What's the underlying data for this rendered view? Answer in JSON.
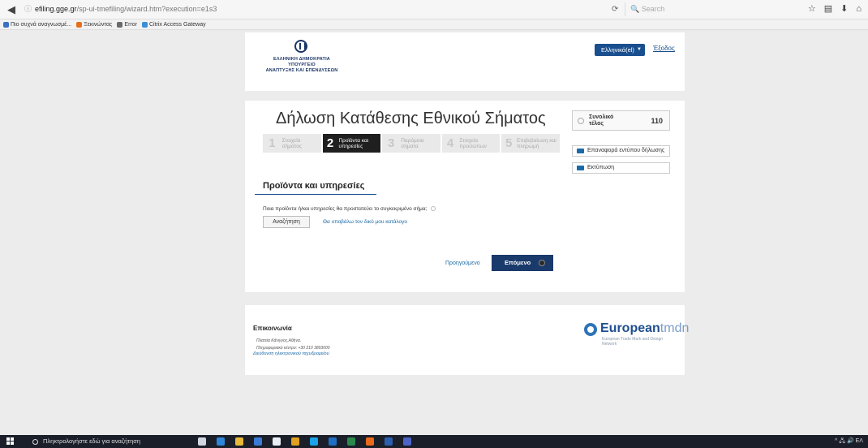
{
  "browser": {
    "url_domain": "efiling.gge.gr",
    "url_prefix": "",
    "url_path": "/sp-ui-tmefiling/wizard.htm?execution=e1s3",
    "search_placeholder": "Search",
    "bookmarks": [
      {
        "label": "Πιο συχνά αναγνωσμέ...",
        "color": "#3a6fc4"
      },
      {
        "label": "Ξεκινώντας",
        "color": "#e76f1a"
      },
      {
        "label": "Error",
        "color": "#6a6a6a"
      },
      {
        "label": "Citrix Access Gateway",
        "color": "#3a8fd8"
      }
    ]
  },
  "header": {
    "org_line1": "ΕΛΛΗΝΙΚΗ ΔΗΜΟΚΡΑΤΙΑ",
    "org_line2": "ΥΠΟΥΡΓΕΙΟ",
    "org_line3": "ΑΝΑΠΤΥΞΗΣ ΚΑΙ ΕΠΕΝΔΥΣΕΩΝ",
    "language": "Ελληνικά(el)",
    "exit": "Έξοδος"
  },
  "main": {
    "title": "Δήλωση Κατάθεσης Εθνικού Σήματος",
    "total_label": "Συνολικό τέλος",
    "total_value": "110",
    "steps": [
      {
        "num": "1",
        "label": "Στοιχεία σήματος",
        "active": false
      },
      {
        "num": "2",
        "label": "Προϊόντα και υπηρεσίες",
        "active": true
      },
      {
        "num": "3",
        "label": "Παρόμοια σήματα",
        "active": false
      },
      {
        "num": "4",
        "label": "Στοιχεία προσώπων",
        "active": false
      },
      {
        "num": "5",
        "label": "Επιβεβαίωση και πληρωμή",
        "active": false
      }
    ],
    "reprint_label": "Επαναφορά εντύπου δήλωσης",
    "print_label": "Εκτύπωση",
    "section_title": "Προϊόντα και υπηρεσίες",
    "question": "Ποια προϊόντα ή/και υπηρεσίες θα προστατεύει το συγκεκριμένο σήμα;",
    "search_button": "Αναζήτηση",
    "upload_link": "Θα υποβάλω τον δικό μου κατάλογο",
    "prev_link": "Προηγούμενο",
    "next_button": "Επόμενο"
  },
  "footer": {
    "contact_title": "Επικοινωνία",
    "address": "Πλατεία Κάνιγγος,Αθήνα.",
    "phone": "Πληροφοριακό κέντρο: +30 210 3893000",
    "email_link": "Διεύθυνση ηλεκτρονικού ταχυδρομείου",
    "tmdn_name_bold": "European",
    "tmdn_name_light": "tmdn",
    "tmdn_sub": "European Trade Mark and Design Network"
  },
  "taskbar": {
    "search_placeholder": "Πληκτρολογήστε εδώ για αναζήτηση",
    "apps": [
      {
        "icon": "task-view-icon",
        "color": "#cfd6e0"
      },
      {
        "icon": "edge-icon",
        "color": "#2f86d8"
      },
      {
        "icon": "file-explorer-icon",
        "color": "#e8b838"
      },
      {
        "icon": "store-icon",
        "color": "#3a7bd5"
      },
      {
        "icon": "mail-icon",
        "color": "#e9edf3"
      },
      {
        "icon": "chrome-icon",
        "color": "#e0a020"
      },
      {
        "icon": "skype-icon",
        "color": "#1aa3e8"
      },
      {
        "icon": "outlook-icon",
        "color": "#1f6fc2"
      },
      {
        "icon": "excel-icon",
        "color": "#2a8a4e"
      },
      {
        "icon": "firefox-icon",
        "color": "#e86a1a"
      },
      {
        "icon": "word-icon",
        "color": "#2b5fae"
      },
      {
        "icon": "teams-icon",
        "color": "#4e63c8"
      }
    ],
    "tray": "^ 🖧 🔊 ΕΛ"
  }
}
